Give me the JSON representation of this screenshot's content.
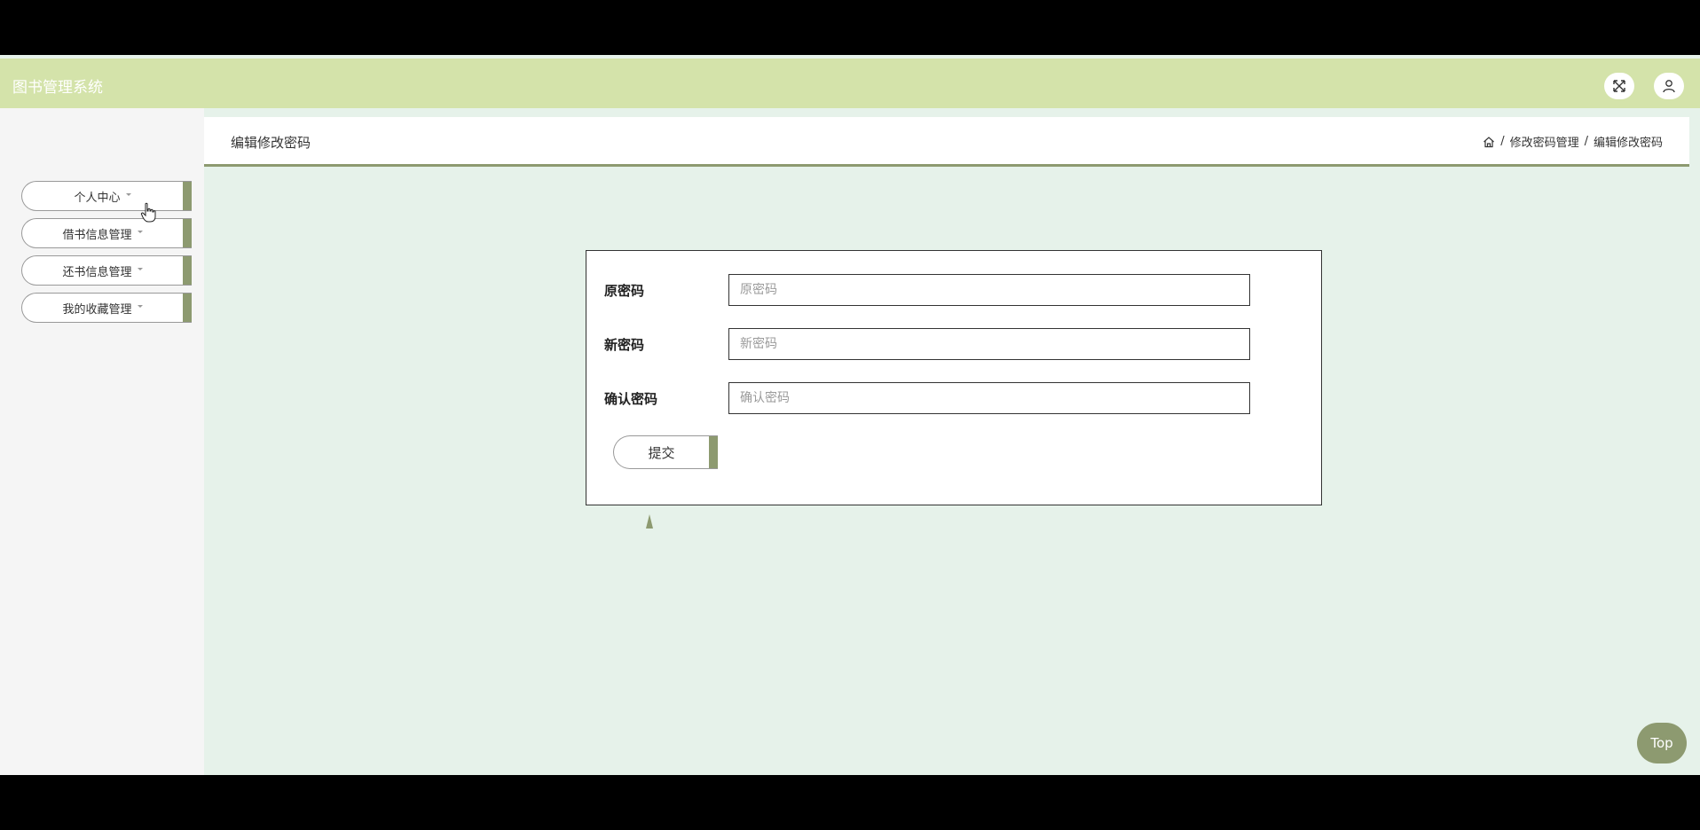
{
  "header": {
    "title": "图书管理系统",
    "fullscreen_icon": "fullscreen-icon",
    "user_icon": "user-icon"
  },
  "sidebar": {
    "items": [
      {
        "label": "个人中心"
      },
      {
        "label": "借书信息管理"
      },
      {
        "label": "还书信息管理"
      },
      {
        "label": "我的收藏管理"
      }
    ]
  },
  "page": {
    "title": "编辑修改密码",
    "breadcrumb": [
      "修改密码管理",
      "编辑修改密码"
    ],
    "breadcrumb_sep": "/"
  },
  "form": {
    "fields": [
      {
        "label": "原密码",
        "placeholder": "原密码",
        "value": ""
      },
      {
        "label": "新密码",
        "placeholder": "新密码",
        "value": ""
      },
      {
        "label": "确认密码",
        "placeholder": "确认密码",
        "value": ""
      }
    ],
    "submit_label": "提交"
  },
  "back_to_top": {
    "label": "Top"
  },
  "colors": {
    "header_bg": "#d4e3aa",
    "accent": "#8d9a70",
    "content_bg": "#e6f2ea",
    "sidebar_bg": "#f5f5f5"
  }
}
